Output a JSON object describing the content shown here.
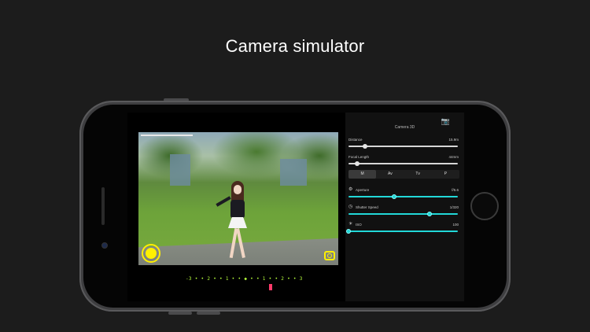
{
  "headline": "Camera simulator",
  "camera_panel": {
    "title": "Camera 3D",
    "distance": {
      "label": "Distance",
      "value": "15.9m",
      "level": 0.15
    },
    "focal_length": {
      "label": "Focal Length",
      "value": "44mm",
      "level": 0.08
    },
    "modes": [
      {
        "label": "M",
        "active": true
      },
      {
        "label": "Av",
        "active": false
      },
      {
        "label": "Tv",
        "active": false
      },
      {
        "label": "P",
        "active": false
      }
    ],
    "aperture": {
      "label": "Aperture",
      "value": "f/5.6",
      "level": 0.42
    },
    "shutter_speed": {
      "label": "Shutter Speed",
      "value": "1/320",
      "level": 0.74
    },
    "iso": {
      "label": "ISO",
      "value": "100",
      "level": 0.0
    }
  },
  "exposure_meter": {
    "scale": "-3 • • 2 • • 1 • • ◆ • • 1 • • 2 • • 3",
    "indicator": 0.83
  },
  "icons": {
    "camera": "camera-icon",
    "shutter": "shutter-button",
    "switch": "camera-switch-icon"
  },
  "colors": {
    "accent": "#22d8d8",
    "shutter": "#fff000",
    "meter": "#b7ff3c",
    "pointer": "#ff3b6b"
  }
}
